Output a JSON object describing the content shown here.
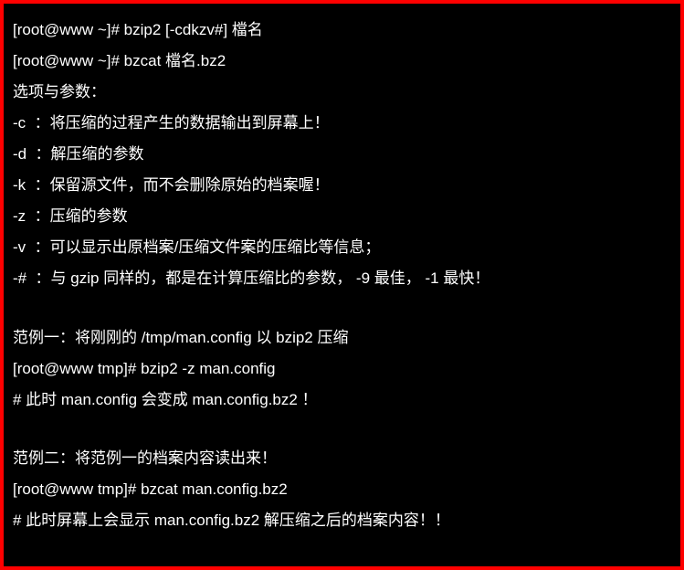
{
  "terminal": {
    "lines": [
      "[root@www ~]# bzip2 [-cdkzv#] 檔名",
      "[root@www ~]# bzcat 檔名.bz2",
      "选项与参数：",
      "-c  ：将压缩的过程产生的数据输出到屏幕上！",
      "-d  ：解压缩的参数",
      "-k  ：保留源文件，而不会删除原始的档案喔！",
      "-z  ：压缩的参数",
      "-v  ：可以显示出原档案/压缩文件案的压缩比等信息；",
      "-#  ：与 gzip 同样的，都是在计算压缩比的参数， -9 最佳， -1 最快！",
      "",
      "范例一：将刚刚的 /tmp/man.config 以 bzip2 压缩",
      "[root@www tmp]# bzip2 -z man.config",
      "# 此时 man.config 会变成 man.config.bz2 ！",
      "",
      "范例二：将范例一的档案内容读出来！",
      "[root@www tmp]# bzcat man.config.bz2",
      "# 此时屏幕上会显示 man.config.bz2 解压缩之后的档案内容！！"
    ]
  }
}
